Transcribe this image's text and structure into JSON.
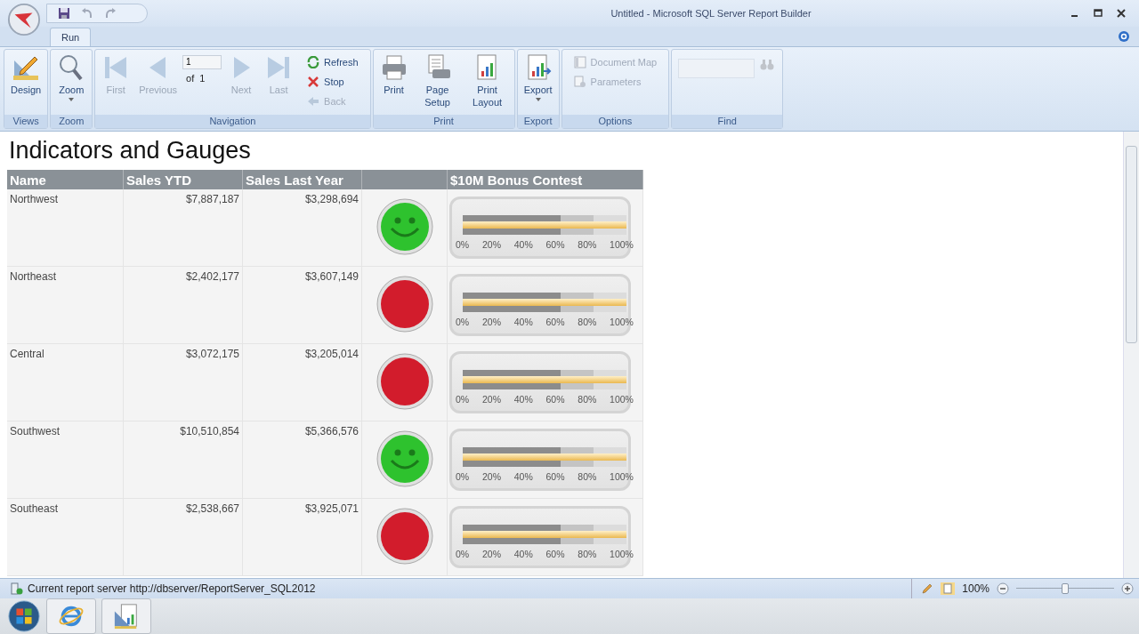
{
  "window": {
    "title": "Untitled - Microsoft SQL Server Report Builder"
  },
  "tabs": [
    {
      "label": "Run",
      "selected": true
    }
  ],
  "ribbon": {
    "groups": [
      {
        "label": "Views",
        "items": [
          {
            "kind": "design",
            "label": "Design",
            "disabled": false,
            "dropdown": false
          }
        ]
      },
      {
        "label": "Zoom",
        "items": [
          {
            "kind": "zoom",
            "label": "Zoom",
            "disabled": false,
            "dropdown": true
          }
        ]
      },
      {
        "label": "Navigation",
        "items": [
          {
            "kind": "first",
            "label": "First",
            "disabled": true,
            "dropdown": false
          },
          {
            "kind": "previous",
            "label": "Previous",
            "disabled": true,
            "dropdown": false
          },
          {
            "kind": "page",
            "value": "1",
            "of_label": "of",
            "total": "1"
          },
          {
            "kind": "next",
            "label": "Next",
            "disabled": true,
            "dropdown": false
          },
          {
            "kind": "last",
            "label": "Last",
            "disabled": true,
            "dropdown": false
          },
          {
            "kind": "refresh",
            "label": "Refresh",
            "disabled": false
          },
          {
            "kind": "stop",
            "label": "Stop",
            "disabled": false
          },
          {
            "kind": "back",
            "label": "Back",
            "disabled": true
          }
        ]
      },
      {
        "label": "Print",
        "items": [
          {
            "kind": "print",
            "label": "Print",
            "disabled": false,
            "dropdown": false
          },
          {
            "kind": "page-setup",
            "label": "Page Setup",
            "disabled": false,
            "dropdown": false
          },
          {
            "kind": "print-layout",
            "label": "Print Layout",
            "disabled": false,
            "dropdown": false
          }
        ]
      },
      {
        "label": "Export",
        "items": [
          {
            "kind": "export",
            "label": "Export",
            "disabled": false,
            "dropdown": true
          }
        ]
      },
      {
        "label": "Options",
        "items": [
          {
            "kind": "document-map",
            "label": "Document Map",
            "disabled": true
          },
          {
            "kind": "parameters",
            "label": "Parameters",
            "disabled": true
          }
        ]
      },
      {
        "label": "Find",
        "items": [
          {
            "kind": "find-field"
          },
          {
            "kind": "find",
            "disabled": true
          }
        ]
      }
    ]
  },
  "report": {
    "title": "Indicators and Gauges",
    "columns": [
      "Name",
      "Sales YTD",
      "Sales Last Year",
      "$10M Bonus Contest"
    ],
    "rows": [
      {
        "name": "Northwest",
        "sales_ytd": "$7,887,187",
        "sales_last_year": "$3,298,694",
        "on_target": true,
        "level": 1,
        "scale": [
          "0%",
          "20%",
          "40%",
          "60%",
          "80%",
          "100%"
        ]
      },
      {
        "name": "Northeast",
        "sales_ytd": "$2,402,177",
        "sales_last_year": "$3,607,149",
        "on_target": false,
        "level": 1,
        "scale": [
          "0%",
          "20%",
          "40%",
          "60%",
          "80%",
          "100%"
        ]
      },
      {
        "name": "Central",
        "sales_ytd": "$3,072,175",
        "sales_last_year": "$3,205,014",
        "on_target": false,
        "level": 1,
        "scale": [
          "0%",
          "20%",
          "40%",
          "60%",
          "80%",
          "100%"
        ]
      },
      {
        "name": "Southwest",
        "sales_ytd": "$10,510,854",
        "sales_last_year": "$5,366,576",
        "on_target": true,
        "level": 1,
        "scale": [
          "0%",
          "20%",
          "40%",
          "60%",
          "80%",
          "100%"
        ]
      },
      {
        "name": "Southeast",
        "sales_ytd": "$2,538,667",
        "sales_last_year": "$3,925,071",
        "on_target": false,
        "level": 1,
        "scale": [
          "0%",
          "20%",
          "40%",
          "60%",
          "80%",
          "100%"
        ]
      }
    ]
  },
  "status_bar": {
    "text": "Current report server http://dbserver/ReportServer_SQL2012",
    "zoom": {
      "label": "100%",
      "level": 0.5
    }
  }
}
